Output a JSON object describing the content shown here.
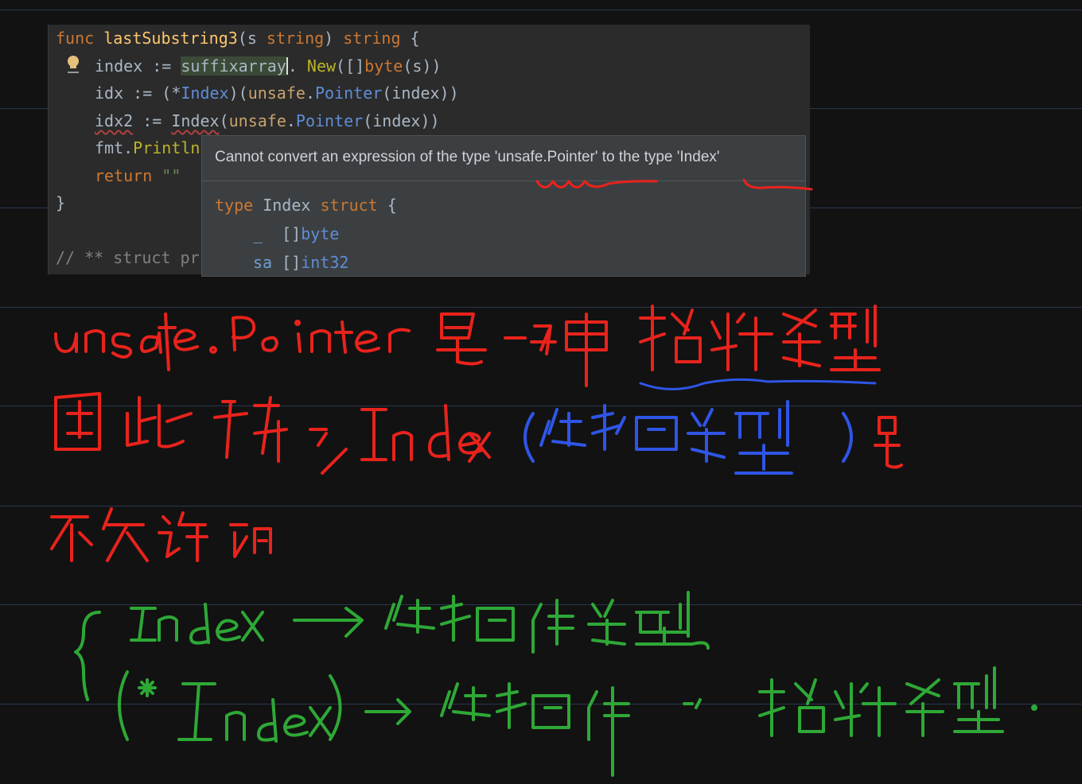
{
  "editor": {
    "lines": [
      {
        "parts": [
          [
            "kw",
            "func "
          ],
          [
            "fn",
            "lastSubstring3"
          ],
          [
            "",
            "(s "
          ],
          [
            "kw",
            "string"
          ],
          [
            "",
            ") "
          ],
          [
            "kw",
            "string"
          ],
          [
            "",
            " {"
          ]
        ]
      },
      {
        "parts": [
          [
            "",
            "index := "
          ],
          [
            "hl",
            "suffixarray"
          ],
          [
            "caret",
            ""
          ],
          [
            "",
            ". "
          ],
          [
            "mt",
            "New"
          ],
          [
            "",
            "([]"
          ],
          [
            "kw",
            "byte"
          ],
          [
            "",
            "(s))"
          ]
        ]
      },
      {
        "parts": [
          [
            "",
            "idx := (*"
          ],
          [
            "ty",
            "Index"
          ],
          [
            "",
            ")("
          ],
          [
            "pk",
            "unsafe"
          ],
          [
            "",
            "."
          ],
          [
            "ty",
            "Pointer"
          ],
          [
            "",
            "(index))"
          ]
        ]
      },
      {
        "parts": [
          [
            "err",
            "idx2"
          ],
          [
            "",
            " := "
          ],
          [
            "err",
            "Index"
          ],
          [
            "",
            "("
          ],
          [
            "pk",
            "unsafe"
          ],
          [
            "",
            "."
          ],
          [
            "ty",
            "Pointer"
          ],
          [
            "",
            "(index))"
          ]
        ]
      },
      {
        "parts": [
          [
            "",
            "fmt."
          ],
          [
            "mt",
            "Println"
          ]
        ]
      },
      {
        "parts": [
          [
            "kw",
            "return "
          ],
          [
            "str",
            "\"\""
          ]
        ]
      },
      {
        "parts": [
          [
            "",
            "}"
          ]
        ]
      },
      {
        "parts": [
          [
            "cm",
            "// ** struct pr"
          ]
        ]
      }
    ]
  },
  "popup": {
    "message": "Cannot convert an expression of the type 'unsafe.Pointer' to the type 'Index'",
    "code": [
      {
        "parts": [
          [
            "kw",
            "type "
          ],
          [
            "",
            "Index "
          ],
          [
            "kw",
            "struct"
          ],
          [
            "",
            " {"
          ]
        ]
      },
      {
        "parts": [
          [
            "fld",
            "_"
          ],
          [
            "",
            "  []"
          ],
          [
            "ty",
            "byte"
          ]
        ]
      },
      {
        "parts": [
          [
            "fld",
            "sa"
          ],
          [
            "",
            " []"
          ],
          [
            "ty",
            "int32"
          ]
        ]
      }
    ]
  },
  "chart_data": {
    "notes": [
      {
        "color": "red",
        "text": "unsafe.Pointer 是一种 指针类型"
      },
      {
        "color": "red+blue",
        "text": "因此 转换 Index（结构类型）是"
      },
      {
        "color": "red",
        "text": "不允许的"
      },
      {
        "color": "green",
        "text": "Index → 结构体类型"
      },
      {
        "color": "green",
        "text": "(*Index) → 结构体的 指针类型."
      }
    ]
  },
  "colors": {
    "ink_red": "#e8231c",
    "ink_blue": "#2f55e6",
    "ink_green": "#2ea836"
  }
}
